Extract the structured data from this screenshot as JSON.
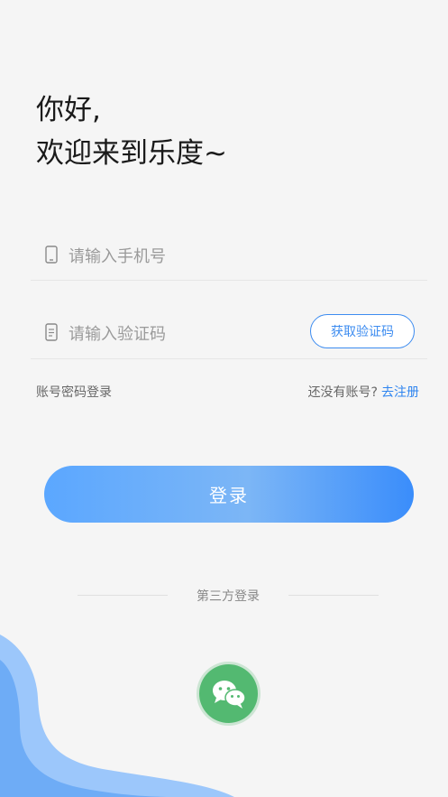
{
  "greeting": {
    "line1": "你好,",
    "line2": "欢迎来到乐度~"
  },
  "phone": {
    "placeholder": "请输入手机号",
    "icon": "phone-icon"
  },
  "code": {
    "placeholder": "请输入验证码",
    "icon": "document-icon",
    "get_code_label": "获取验证码"
  },
  "links": {
    "password_login": "账号密码登录",
    "no_account": "还没有账号?",
    "register": "去注册"
  },
  "login_button": "登录",
  "third_party": {
    "label": "第三方登录",
    "wechat_icon": "wechat-icon"
  },
  "colors": {
    "accent": "#3d8cf0",
    "wechat": "#53b971",
    "background": "#f5f5f5"
  }
}
